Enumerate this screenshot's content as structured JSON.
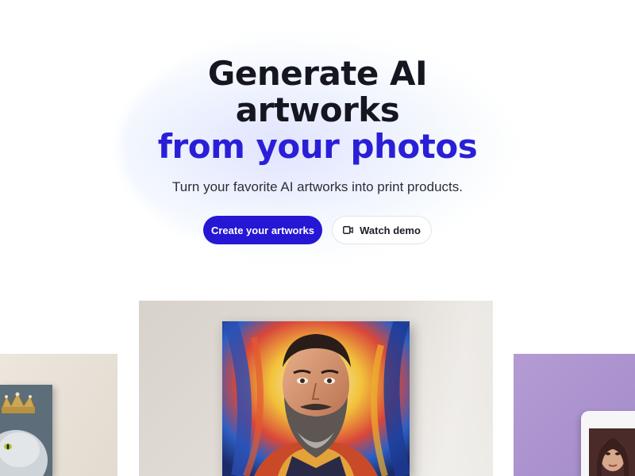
{
  "hero": {
    "headline_line1": "Generate AI",
    "headline_line2": "artworks",
    "headline_accent": "from your photos",
    "subtitle": "Turn your favorite AI artworks into print products."
  },
  "buttons": {
    "primary_label": "Create your artworks",
    "secondary_label": "Watch demo",
    "secondary_icon": "video-camera-icon"
  },
  "colors": {
    "accent": "#2a1fd6",
    "primary_button": "#2517d4",
    "text_dark": "#15161f"
  },
  "showcase": {
    "left": "cat-with-crown-canvas",
    "center": "bearded-man-portrait-canvas",
    "right": "portrait-mug"
  }
}
